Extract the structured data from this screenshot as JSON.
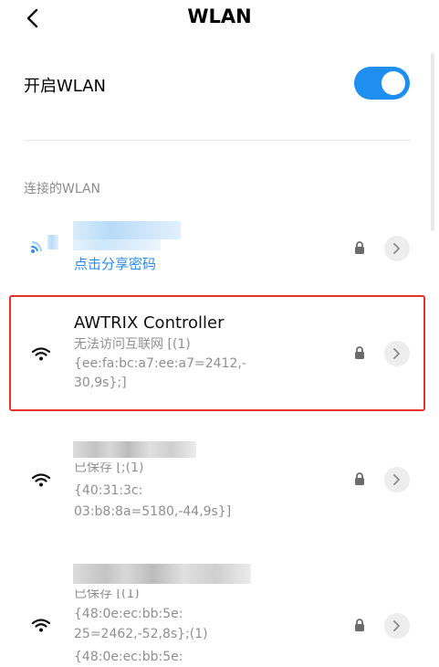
{
  "header": {
    "title": "WLAN"
  },
  "wlan_toggle": {
    "label": "开启WLAN",
    "on": true,
    "accent": "#1e8ff0"
  },
  "section": {
    "connected_label": "连接的WLAN"
  },
  "networks": [
    {
      "name": "",
      "subtitle": "点击分享密码",
      "icon": "wifi-icon",
      "secured": true
    },
    {
      "name": "AWTRIX Controller",
      "subtitle_lines": [
        "无法访问互联网 [(1)",
        "{ee:fa:bc:a7:ee:a7=2412,-",
        "30,9s};]"
      ],
      "icon": "wifi-icon",
      "secured": true,
      "highlighted": true,
      "highlight_color": "#e8302c"
    },
    {
      "name": "",
      "subtitle_lines": [
        "已保存 [;(1)",
        "{40:31:3c:",
        "03:b8:8a=5180,-44,9s}]"
      ],
      "icon": "wifi-icon",
      "secured": true
    },
    {
      "name": "",
      "subtitle_lines": [
        "已保存 [(1)",
        "{48:0e:ec:bb:5e:",
        "25=2462,-52,8s};(1)",
        "{48:0e:ec:bb:5e:"
      ],
      "icon": "wifi-icon",
      "secured": true
    }
  ]
}
